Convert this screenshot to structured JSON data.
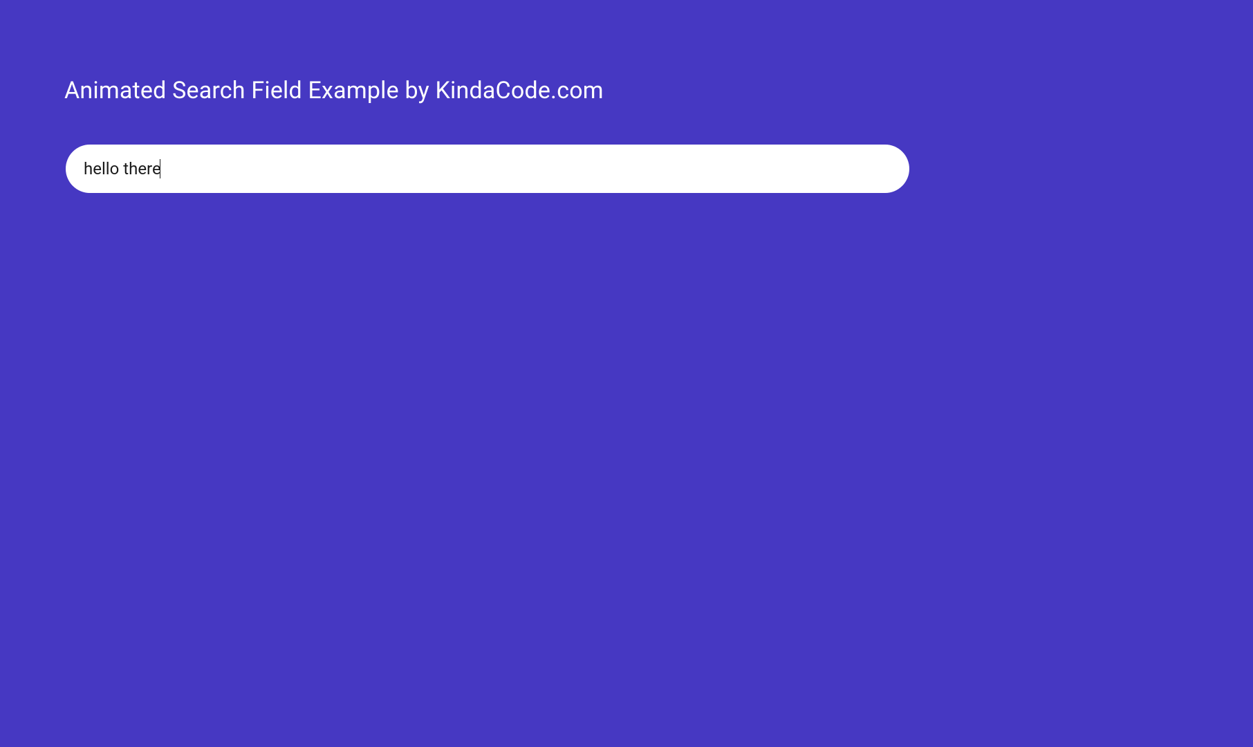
{
  "header": {
    "title": "Animated Search Field Example by KindaCode.com"
  },
  "search": {
    "value": "hello there",
    "placeholder": ""
  },
  "colors": {
    "background": "#4638c2",
    "input_bg": "#ffffff",
    "title_text": "#ffffff",
    "input_text": "#1a1a1a"
  }
}
